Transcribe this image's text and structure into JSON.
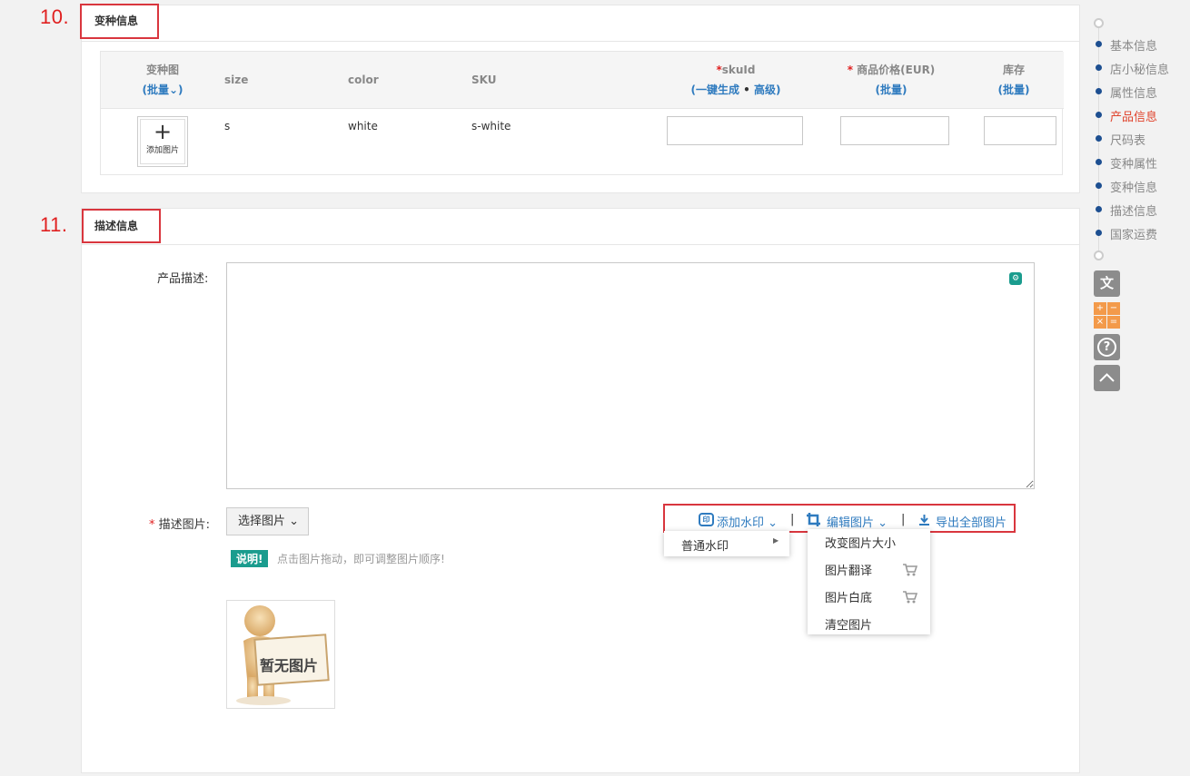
{
  "annotations": {
    "num10": "10.",
    "num11": "11."
  },
  "variants_section": {
    "title": "变种信息",
    "columns": {
      "image_label": "变种图",
      "image_batch_open": "(",
      "image_batch": "批量",
      "image_batch_close": ")",
      "size": "size",
      "color": "color",
      "sku": "SKU",
      "skuid_star": "*",
      "skuid": "skuId",
      "skuid_sub_open": "(",
      "skuid_gen": "一键生成",
      "skuid_dot": " • ",
      "skuid_adv": "高级",
      "skuid_sub_close": ")",
      "price_star": "* ",
      "price": "商品价格(EUR)",
      "price_batch_open": "(",
      "price_batch": "批量",
      "price_batch_close": ")",
      "stock": "库存",
      "stock_batch_open": "(",
      "stock_batch": "批量",
      "stock_batch_close": ")"
    },
    "rows": [
      {
        "add_image": "添加图片",
        "size": "s",
        "color": "white",
        "sku": "s-white",
        "skuid": "",
        "price": "",
        "stock": ""
      }
    ]
  },
  "desc_section": {
    "title": "描述信息",
    "product_desc_label": "产品描述:",
    "product_desc_value": "",
    "desc_images_star": "* ",
    "desc_images_label": "描述图片:",
    "select_images_button": "选择图片",
    "note_badge": "说明!",
    "note_text": "点击图片拖动，即可调整图片顺序!",
    "placeholder_image_text": "暂无图片",
    "toolbar": {
      "add_watermark": "添加水印",
      "edit_image": "编辑图片",
      "export_all": "导出全部图片",
      "sep": "|"
    },
    "watermark_menu": [
      "普通水印"
    ],
    "edit_menu": [
      "改变图片大小",
      "图片翻译",
      "图片白底",
      "清空图片"
    ]
  },
  "side_nav": {
    "items": [
      "基本信息",
      "店小秘信息",
      "属性信息",
      "产品信息",
      "尺码表",
      "变种属性",
      "变种信息",
      "描述信息",
      "国家运费"
    ],
    "active_index": 3
  },
  "colors": {
    "accent_blue": "#2f7bbf",
    "active_red": "#e0442d",
    "nav_dot": "#1d4f91",
    "badge_teal": "#1a9c8e",
    "annotation_red": "#d9363e"
  }
}
